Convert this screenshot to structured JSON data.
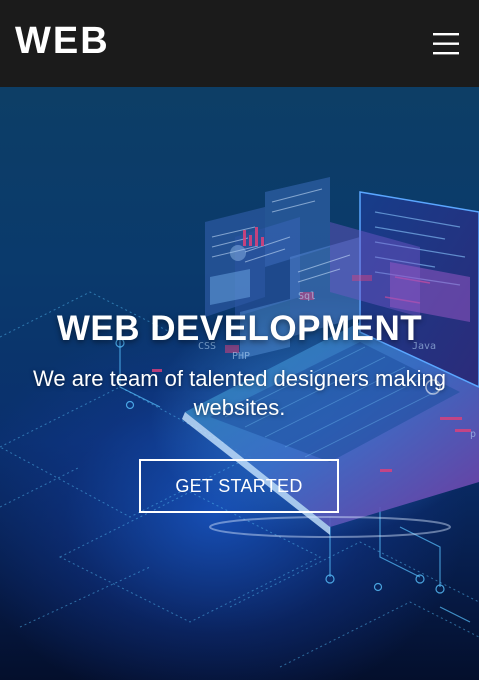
{
  "navbar": {
    "logo_text": "WEB",
    "menu_icon": "hamburger-menu-icon"
  },
  "hero": {
    "background_image": "isometric-laptop-code-illustration",
    "title": "WEB DEVELOPMENT",
    "subtitle": "We are team of talented designers making websites.",
    "cta_label": "GET STARTED"
  },
  "colors": {
    "navbar_bg": "#1b1b1b",
    "hero_bg_top": "#0d3e66",
    "hero_bg_bottom": "#040f2c",
    "text": "#ffffff",
    "accent_pink": "#e0407a"
  }
}
